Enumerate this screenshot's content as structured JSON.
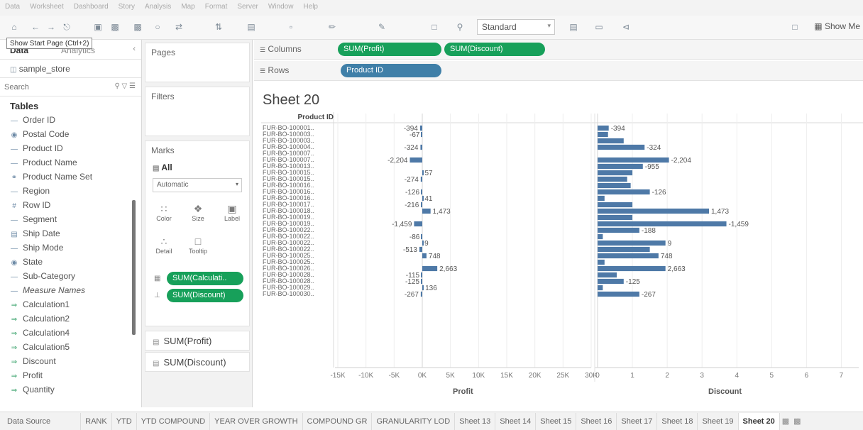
{
  "menubar": [
    "Data",
    "Worksheet",
    "Dashboard",
    "Story",
    "Analysis",
    "Map",
    "Format",
    "Server",
    "Window",
    "Help"
  ],
  "toolbar": {
    "fit_select": "Standard",
    "show_me": "Show Me",
    "tooltip": "Show Start Page (Ctrl+2)"
  },
  "left_panel": {
    "tab_data": "Data",
    "tab_analytics": "Analytics",
    "datasource": "sample_store",
    "search_placeholder": "Search",
    "tables_heading": "Tables",
    "fields": [
      {
        "name": "Order ID",
        "kind": "dim"
      },
      {
        "name": "Postal Code",
        "kind": "geo"
      },
      {
        "name": "Product ID",
        "kind": "dim"
      },
      {
        "name": "Product Name",
        "kind": "dim"
      },
      {
        "name": "Product Name Set",
        "kind": "set"
      },
      {
        "name": "Region",
        "kind": "dim"
      },
      {
        "name": "Row ID",
        "kind": "num"
      },
      {
        "name": "Segment",
        "kind": "dim"
      },
      {
        "name": "Ship Date",
        "kind": "date"
      },
      {
        "name": "Ship Mode",
        "kind": "dim"
      },
      {
        "name": "State",
        "kind": "geo"
      },
      {
        "name": "Sub-Category",
        "kind": "dim"
      },
      {
        "name": "Measure Names",
        "kind": "dim",
        "italic": true
      },
      {
        "name": "Calculation1",
        "kind": "measure"
      },
      {
        "name": "Calculation2",
        "kind": "measure"
      },
      {
        "name": "Calculation4",
        "kind": "measure"
      },
      {
        "name": "Calculation5",
        "kind": "measure"
      },
      {
        "name": "Discount",
        "kind": "measure"
      },
      {
        "name": "Profit",
        "kind": "measure"
      },
      {
        "name": "Quantity",
        "kind": "measure"
      }
    ]
  },
  "cards": {
    "pages": "Pages",
    "filters": "Filters",
    "marks": "Marks",
    "marks_all": "All",
    "marks_type": "Automatic",
    "buttons": [
      "Color",
      "Size",
      "Label",
      "Detail",
      "Tooltip"
    ],
    "pill_calc": "SUM(Calculati..",
    "pill_discount": "SUM(Discount)",
    "measure_profit": "SUM(Profit)",
    "measure_discount": "SUM(Discount)"
  },
  "shelves": {
    "columns_label": "Columns",
    "rows_label": "Rows",
    "col_pills": [
      "SUM(Profit)",
      "SUM(Discount)"
    ],
    "row_pills": [
      "Product ID"
    ]
  },
  "sheet_title": "Sheet 20",
  "row_header": "Product ID",
  "chart_data": {
    "type": "bar",
    "orientation": "horizontal",
    "row_labels": [
      "FUR-BO-100001..",
      "FUR-BO-100003..",
      "FUR-BO-100003..",
      "FUR-BO-100004..",
      "FUR-BO-100007..",
      "FUR-BO-100007..",
      "FUR-BO-100013..",
      "FUR-BO-100015..",
      "FUR-BO-100015..",
      "FUR-BO-100016..",
      "FUR-BO-100016..",
      "FUR-BO-100016..",
      "FUR-BO-100017..",
      "FUR-BO-100018..",
      "FUR-BO-100019..",
      "FUR-BO-100019..",
      "FUR-BO-100022..",
      "FUR-BO-100022..",
      "FUR-BO-100022..",
      "FUR-BO-100022..",
      "FUR-BO-100025..",
      "FUR-BO-100025..",
      "FUR-BO-100026..",
      "FUR-BO-100028..",
      "FUR-BO-100028..",
      "FUR-BO-100029..",
      "FUR-BO-100030.."
    ],
    "series": [
      {
        "name": "Profit",
        "xlabel": "Profit",
        "xlim": [
          -15000,
          30000
        ],
        "ticks": [
          "-15K",
          "-10K",
          "-5K",
          "0K",
          "5K",
          "10K",
          "15K",
          "20K",
          "25K",
          "30K"
        ],
        "tick_values": [
          -15000,
          -10000,
          -5000,
          0,
          5000,
          10000,
          15000,
          20000,
          25000,
          30000
        ],
        "values": [
          -394,
          -67,
          null,
          -324,
          null,
          -2204,
          null,
          57,
          -274,
          null,
          -126,
          41,
          -216,
          1473,
          null,
          -1459,
          null,
          -86,
          9,
          -513,
          748,
          null,
          2663,
          -115,
          -125,
          136,
          -267
        ],
        "labels": [
          "-394",
          "-67",
          "",
          "-324",
          "",
          "-2,204",
          "",
          "57",
          "-274",
          "",
          "-126",
          "41",
          "-216",
          "1,473",
          "",
          "-1,459",
          "",
          "-86",
          "9",
          "-513",
          "748",
          "",
          "2,663",
          "-115",
          "-125",
          "136",
          "-267"
        ]
      },
      {
        "name": "Discount",
        "xlabel": "Discount",
        "xlim": [
          0,
          7.5
        ],
        "ticks": [
          "0",
          "1",
          "2",
          "3",
          "4",
          "5",
          "6",
          "7"
        ],
        "tick_values": [
          0,
          1,
          2,
          3,
          4,
          5,
          6,
          7
        ],
        "values": [
          0.32,
          0.3,
          0.75,
          1.35,
          null,
          2.05,
          1.3,
          1.0,
          0.85,
          0.95,
          1.5,
          0.2,
          1.0,
          3.2,
          1.0,
          3.7,
          1.2,
          0.15,
          1.95,
          1.5,
          1.75,
          0.2,
          1.95,
          0.55,
          0.75,
          0.15,
          1.2
        ],
        "labels": [
          "-394",
          "",
          "",
          "-324",
          "",
          "-2,204",
          "-955",
          "",
          "",
          "",
          "-126",
          "",
          "",
          "1,473",
          "",
          "-1,459",
          "-188",
          "",
          "9",
          "",
          "748",
          "",
          "2,663",
          "",
          "-125",
          "",
          "-267"
        ]
      }
    ],
    "bar_color": "#4e79a7",
    "grid": true
  },
  "tabs": [
    "Data Source",
    "RANK",
    "YTD",
    "YTD COMPOUND",
    "YEAR OVER GROWTH",
    "COMPOUND GR",
    "GRANULARITY LOD",
    "Sheet 13",
    "Sheet 14",
    "Sheet 15",
    "Sheet 16",
    "Sheet 17",
    "Sheet 18",
    "Sheet 19",
    "Sheet 20"
  ],
  "active_tab": "Sheet 20"
}
